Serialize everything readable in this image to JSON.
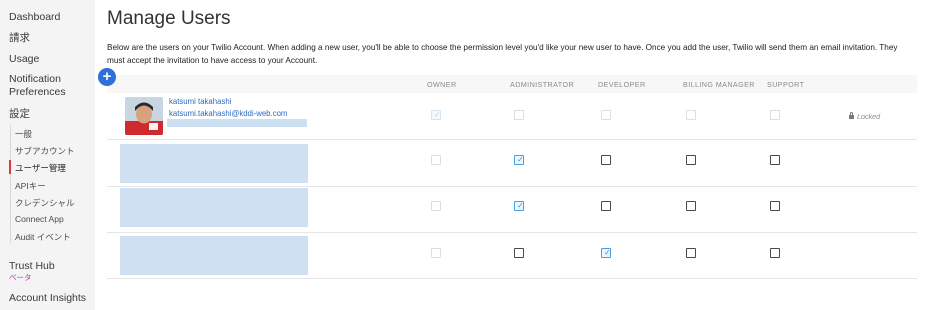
{
  "sidebar": {
    "items": [
      {
        "label": "Dashboard"
      },
      {
        "label": "請求"
      },
      {
        "label": "Usage"
      },
      {
        "label": "Notification Preferences"
      },
      {
        "label": "設定"
      },
      {
        "label": "Trust Hub"
      },
      {
        "label": "Account Insights"
      }
    ],
    "trust_hub_badge": "ベータ",
    "settings_sub": [
      {
        "label": "一般"
      },
      {
        "label": "サブアカウント"
      },
      {
        "label": "ユーザー管理"
      },
      {
        "label": "APIキー"
      },
      {
        "label": "クレデンシャル"
      },
      {
        "label": "Connect App"
      },
      {
        "label": "Audit イベント"
      }
    ],
    "active_sub": "ユーザー管理"
  },
  "main": {
    "title": "Manage Users",
    "description": "Below are the users on your Twilio Account. When adding a new user, you'll be able to choose the permission level you'd like your new user to have. Once you add the user, Twilio will send them an email invitation. They must accept the invitation to have access to your Account.",
    "add_button": "+",
    "columns": [
      "OWNER",
      "ADMINISTRATOR",
      "DEVELOPER",
      "BILLING MANAGER",
      "SUPPORT"
    ],
    "users": [
      {
        "name": "katsumi takahashi",
        "email": "katsumi.takahashi@kddi-web.com",
        "roles": {
          "owner": true,
          "administrator": false,
          "developer": false,
          "billing_manager": false,
          "support": false
        },
        "status": "Locked"
      },
      {
        "roles": {
          "owner": false,
          "administrator": true,
          "developer": false,
          "billing_manager": false,
          "support": false
        }
      },
      {
        "roles": {
          "owner": false,
          "administrator": true,
          "developer": false,
          "billing_manager": false,
          "support": false
        }
      },
      {
        "roles": {
          "owner": false,
          "administrator": false,
          "developer": true,
          "billing_manager": false,
          "support": false
        }
      }
    ]
  },
  "colors": {
    "accent": "#2f6fd6",
    "link": "#2c6dbe",
    "active_marker": "#e0343e",
    "beta": "#b03aa6",
    "redaction": "#cfe0f2"
  }
}
